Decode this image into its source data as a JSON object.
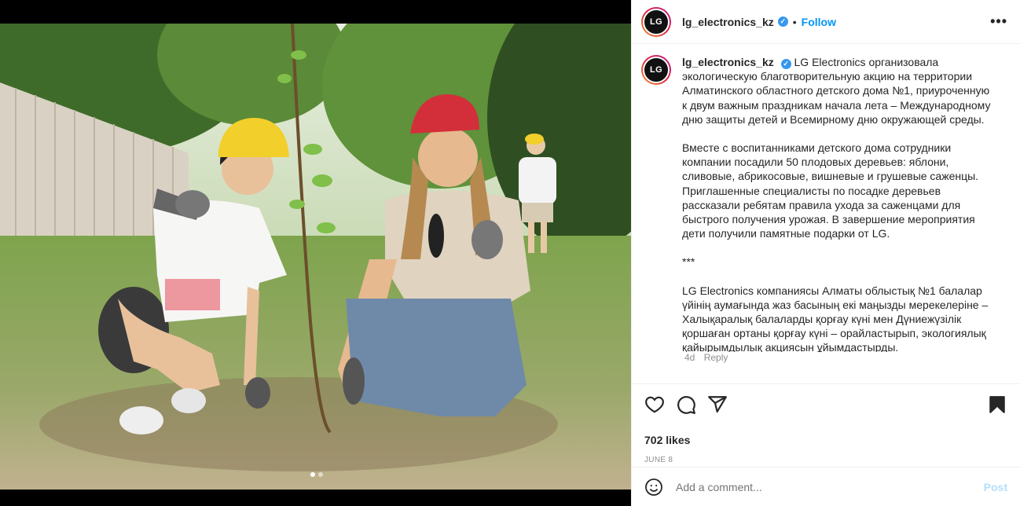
{
  "post": {
    "username": "lg_electronics_kz",
    "avatar_text": "LG",
    "follow_label": "Follow",
    "bullet": "•",
    "more_label": "•••",
    "caption": {
      "username": "lg_electronics_kz",
      "paragraphs": [
        "LG Electronics организовала экологическую благотворительную акцию на территории Алматинского областного детского дома №1, приуроченную к двум важным праздникам начала лета – Международному дню защиты детей и Всемирному дню окружающей среды.",
        "Вместе с воспитанниками детского дома сотрудники компании посадили 50 плодовых деревьев: яблони, сливовые, абрикосовые, вишневые и грушевые саженцы. Приглашенные специалисты по посадке деревьев рассказали ребятам правила ухода за саженцами для быстрого получения урожая. В завершение мероприятия дети получили памятные подарки от LG.",
        "***",
        "LG Electronics компаниясы Алматы облыстық №1 балалар үйінің аумағында жаз басының екі маңызды мерекелеріне – Халықаралық балаларды қорғау күні мен Дүниежүзілік қоршаған ортаны қорғау күні – орайластырып, экологиялық қайырымдылық акциясын ұйымдастырды."
      ],
      "age": "4d",
      "reply_label": "Reply"
    },
    "likes": "702 likes",
    "date": "JUNE 8",
    "comment_placeholder": "Add a comment...",
    "post_label": "Post",
    "colors": {
      "link_blue": "#0095f6",
      "post_disabled": "#b2dffc",
      "text": "#262626",
      "muted": "#8e8e8e"
    },
    "icons": [
      "heart-icon",
      "comment-icon",
      "share-icon",
      "bookmark-icon",
      "emoji-icon",
      "verified-icon",
      "more-icon"
    ]
  }
}
